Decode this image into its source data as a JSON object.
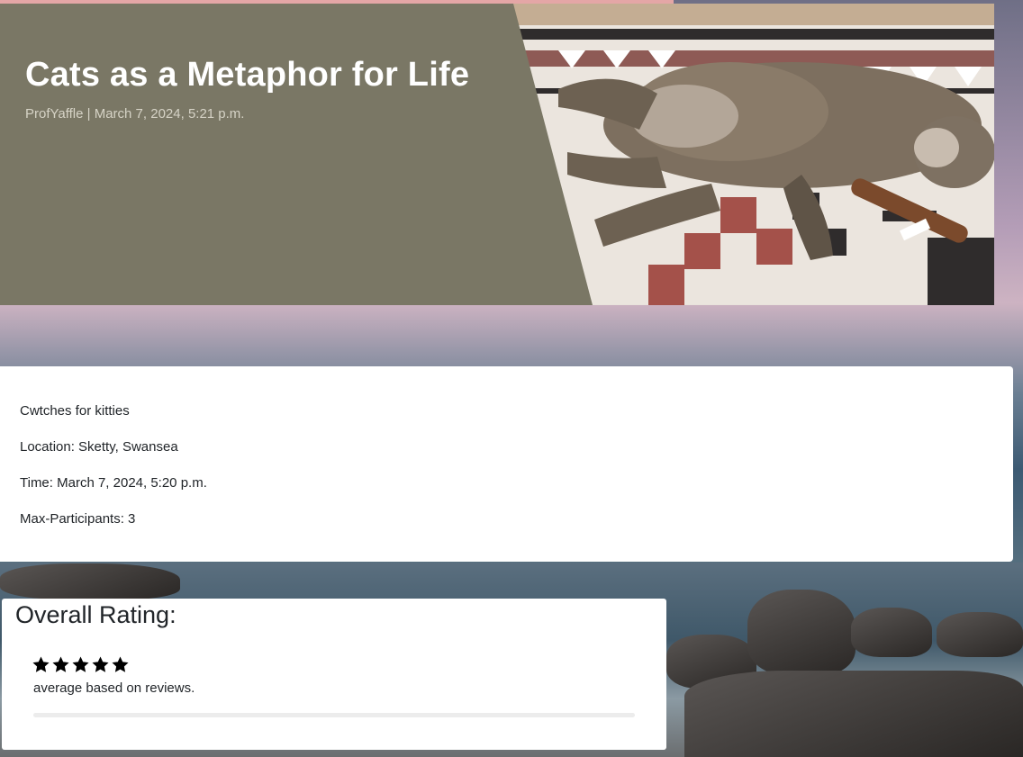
{
  "post": {
    "title": "Cats as a Metaphor for Life",
    "meta": "ProfYaffle | March 7, 2024, 5:21 p.m."
  },
  "event": {
    "name": "Cwtches for kitties",
    "location": "Location: Sketty, Swansea",
    "time": "Time: March 7, 2024, 5:20 p.m.",
    "max_participants": "Max-Participants: 3"
  },
  "rating": {
    "heading": "Overall Rating:",
    "stars_filled": 5,
    "stars_total": 5,
    "average_text": "average based on reviews.",
    "progress_fraction": 0
  },
  "colors": {
    "hero_panel": "#7a7765",
    "card": "#ffffff",
    "star": "#000000",
    "accent_strip": "#e4a6a6"
  },
  "icons": [
    "star-icon"
  ]
}
